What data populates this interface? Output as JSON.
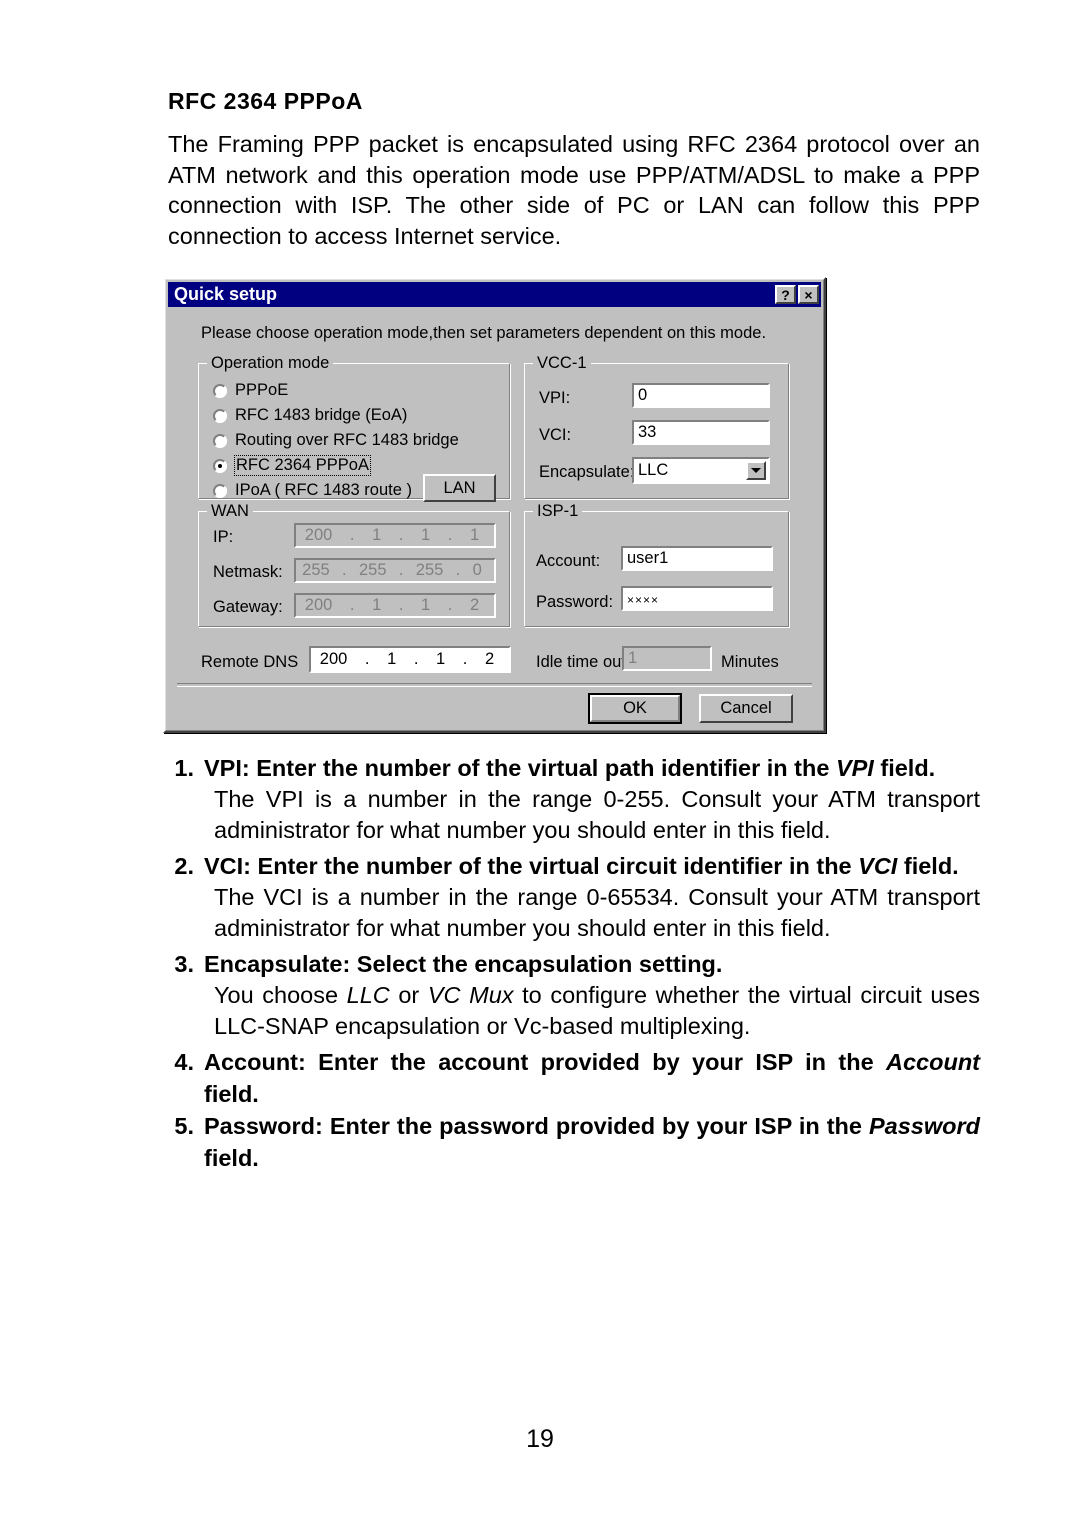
{
  "document": {
    "heading": "RFC 2364 PPPoA",
    "intro": "The Framing PPP packet is encapsulated using RFC 2364 protocol over an ATM network and this operation mode use PPP/ATM/ADSL to make a PPP connection with ISP.  The other side of PC or LAN can follow this PPP connection to access Internet service.",
    "page_number": "19",
    "list": [
      {
        "num": "1.",
        "title_pre": "VPI: Enter the number of the virtual path identifier in the ",
        "title_em": "VPI",
        "title_post": " field.",
        "explain": "The VPI is a number in the range 0-255. Consult your ATM transport administrator for what number you should enter in this field."
      },
      {
        "num": "2.",
        "title_pre": "VCI: Enter the number of the virtual circuit identifier in the ",
        "title_em": "VCI",
        "title_post": " field.",
        "explain": "The VCI is a number in the range 0-65534. Consult your ATM transport administrator for what number you should enter in this field."
      },
      {
        "num": "3.",
        "title_pre": "Encapsulate: Select the encapsulation setting.",
        "title_em": "",
        "title_post": "",
        "explain_pre": "You choose ",
        "explain_em1": "LLC",
        "explain_mid": " or ",
        "explain_em2": "VC Mux",
        "explain_post": " to configure whether the virtual circuit uses LLC-SNAP encapsulation or Vc-based multiplexing."
      },
      {
        "num": "4.",
        "title_pre": "Account: Enter the account provided by your ISP in the ",
        "title_em": "Account",
        "title_post": " field.",
        "explain": ""
      },
      {
        "num": "5.",
        "title_pre": "Password: Enter the password provided by your ISP in the ",
        "title_em": "Password",
        "title_post": " field.",
        "explain": ""
      }
    ]
  },
  "dialog": {
    "title": "Quick setup",
    "help_button": "?",
    "close_button": "×",
    "hint": "Please choose operation mode,then set parameters dependent on  this mode.",
    "operation_mode": {
      "legend": "Operation mode",
      "options": [
        {
          "label": "PPPoE",
          "checked": false
        },
        {
          "label": "RFC 1483 bridge (EoA)",
          "checked": false
        },
        {
          "label": "Routing over RFC 1483 bridge",
          "checked": false
        },
        {
          "label": "RFC 2364 PPPoA",
          "checked": true
        },
        {
          "label": "IPoA ( RFC 1483 route )",
          "checked": false
        }
      ],
      "lan_button": "LAN"
    },
    "vcc": {
      "legend": "VCC-1",
      "vpi_label": "VPI:",
      "vpi_value": "0",
      "vci_label": "VCI:",
      "vci_value": "33",
      "encapsulate_label": "Encapsulate:",
      "encapsulate_value": "LLC",
      "encapsulate_options": [
        "LLC",
        "VC Mux"
      ]
    },
    "wan": {
      "legend": "WAN",
      "ip_label": "IP:",
      "ip_value": [
        "200",
        "1",
        "1",
        "1"
      ],
      "netmask_label": "Netmask:",
      "netmask_value": [
        "255",
        "255",
        "255",
        "0"
      ],
      "gateway_label": "Gateway:",
      "gateway_value": [
        "200",
        "1",
        "1",
        "2"
      ]
    },
    "isp": {
      "legend": "ISP-1",
      "account_label": "Account:",
      "account_value": "user1",
      "password_label": "Password:",
      "password_value": "××××"
    },
    "remote_dns": {
      "label": "Remote DNS",
      "value": [
        "200",
        "1",
        "1",
        "2"
      ]
    },
    "idle": {
      "label": "Idle time out",
      "value": "1",
      "units": "Minutes"
    },
    "ok_button": "OK",
    "cancel_button": "Cancel",
    "colors": {
      "titlebar": "#000080",
      "face": "#c0c0c0",
      "field": "#ffffff",
      "disabled_text": "#808080"
    }
  }
}
